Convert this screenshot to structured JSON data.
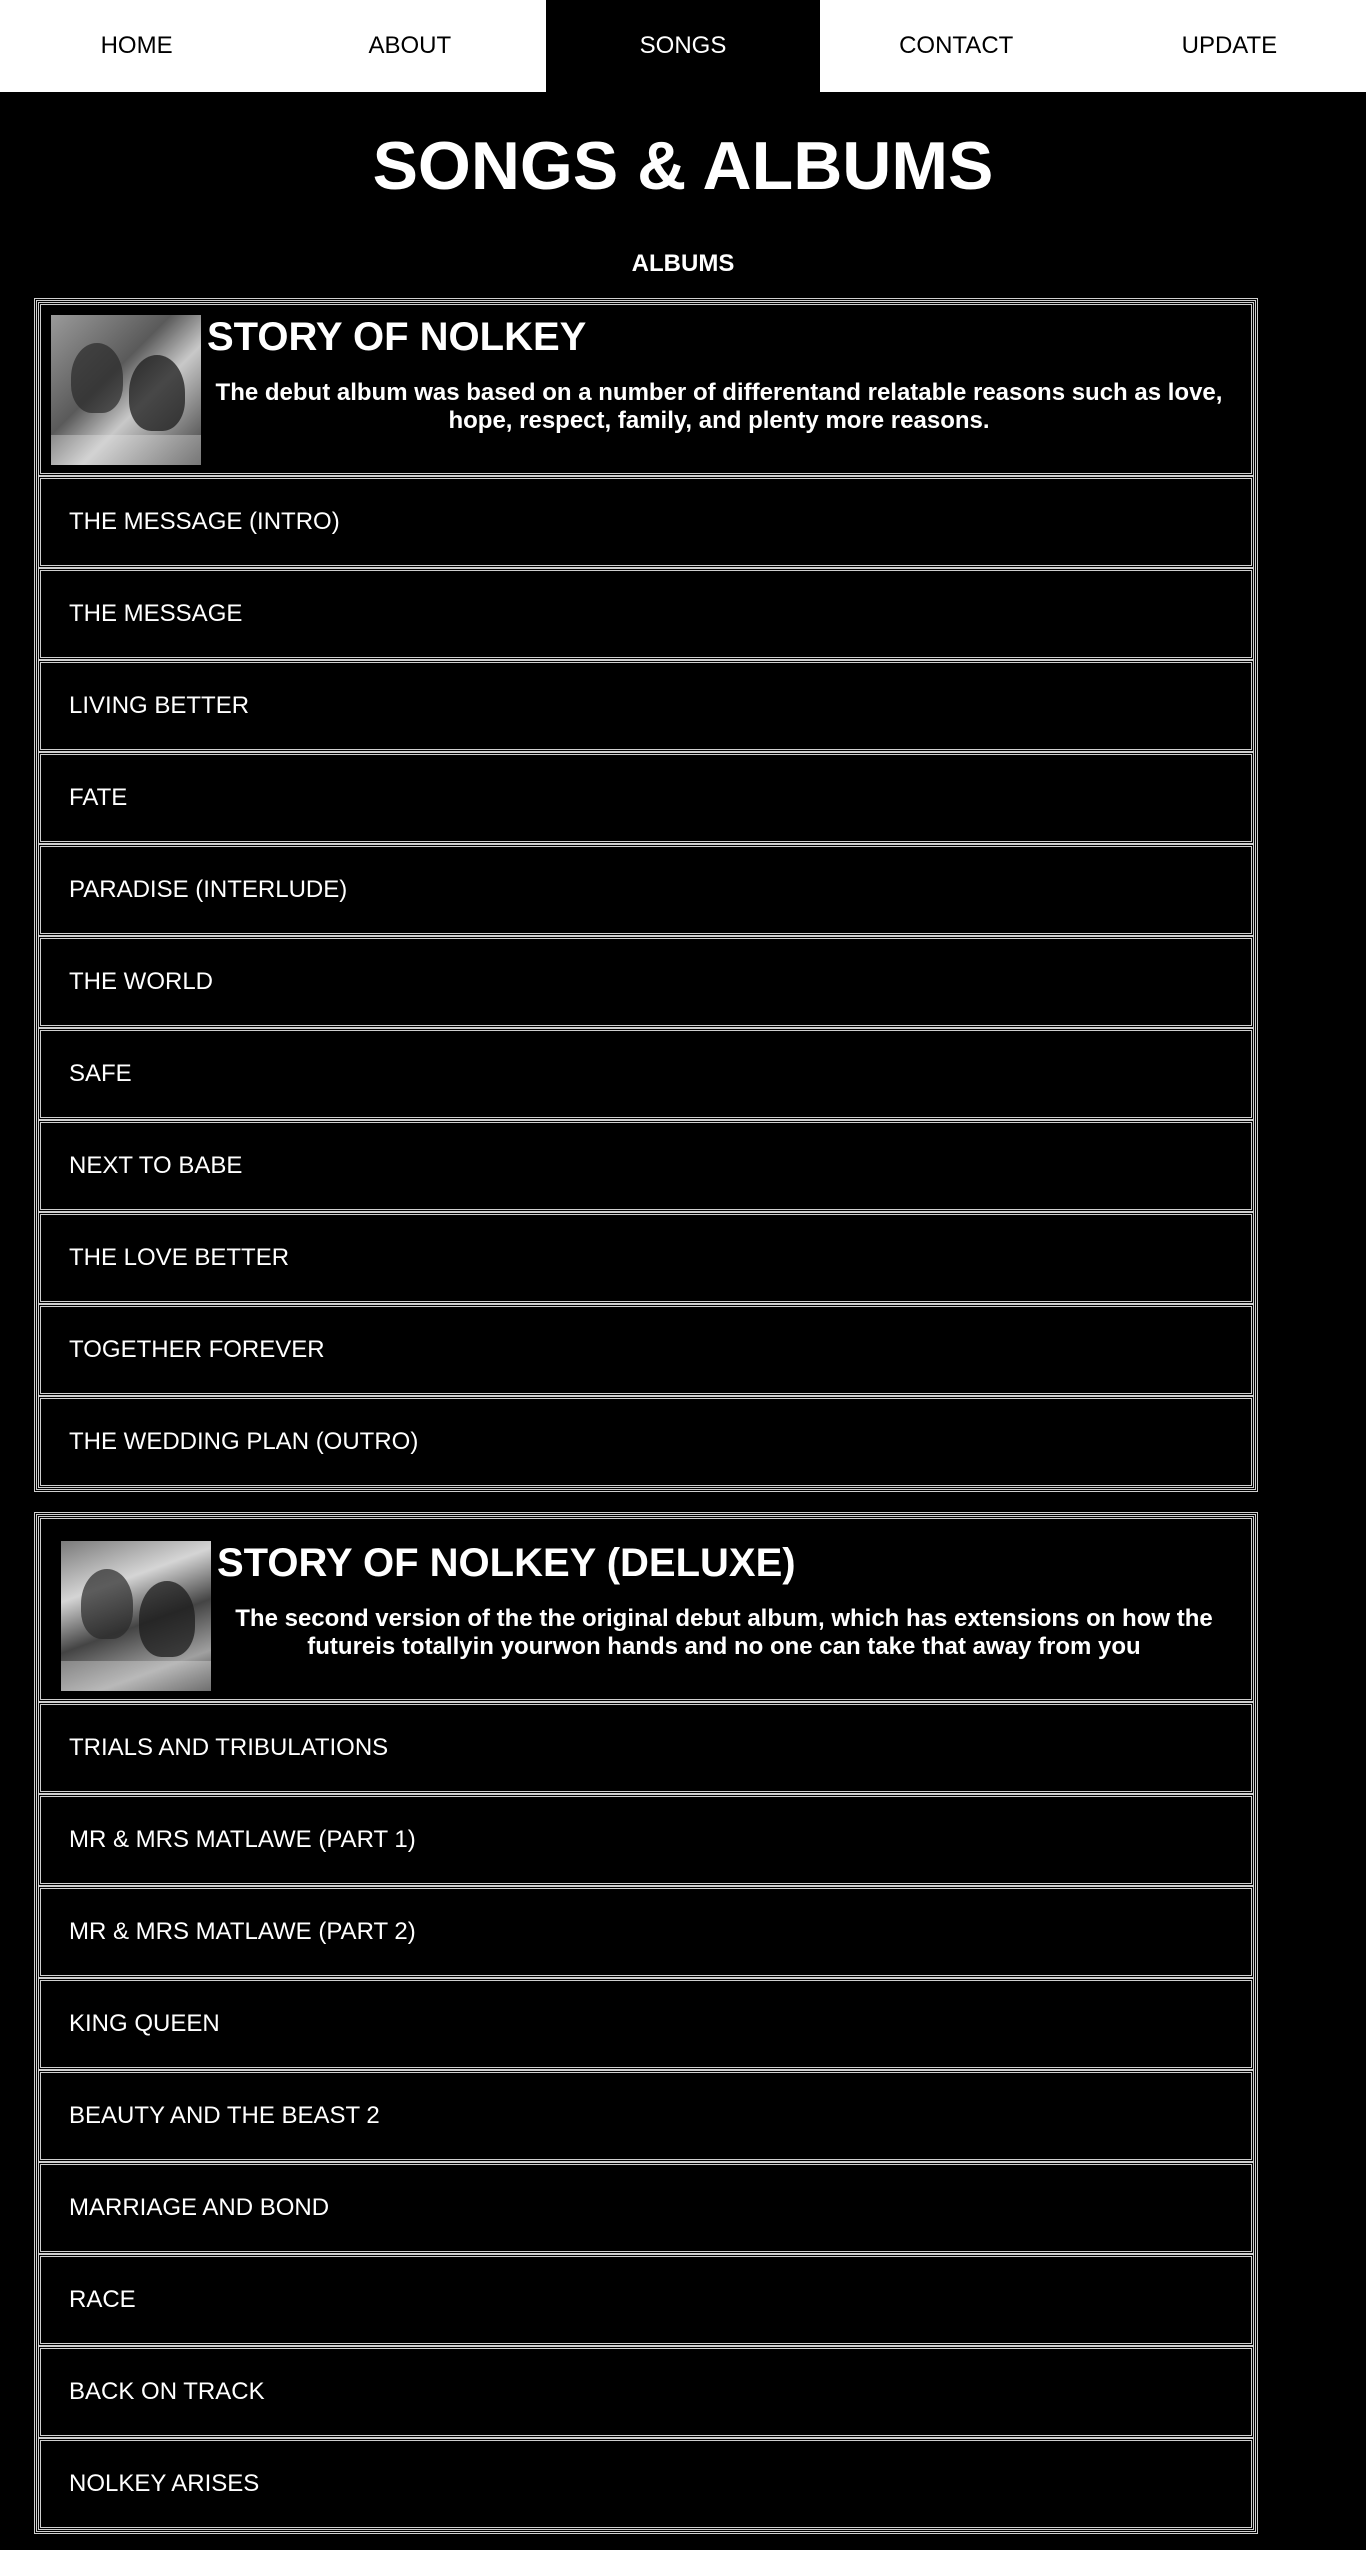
{
  "nav": {
    "items": [
      {
        "label": "HOME",
        "active": false
      },
      {
        "label": "ABOUT",
        "active": false
      },
      {
        "label": "SONGS",
        "active": true
      },
      {
        "label": "CONTACT",
        "active": false
      },
      {
        "label": "UPDATE",
        "active": false
      }
    ]
  },
  "page": {
    "title": "SONGS & ALBUMS",
    "section": "ALBUMS"
  },
  "albums": [
    {
      "title": "STORY OF NOLKEY",
      "description": "The debut album was based on a number of differentand relatable reasons such as love, hope, respect, family, and plenty more reasons.",
      "tracks": [
        "THE MESSAGE (INTRO)",
        "THE MESSAGE",
        "LIVING BETTER",
        "FATE",
        "PARADISE (INTERLUDE)",
        "THE WORLD",
        "SAFE",
        "NEXT TO BABE",
        "THE LOVE BETTER",
        "TOGETHER FOREVER",
        "THE WEDDING PLAN (OUTRO)"
      ]
    },
    {
      "title": "STORY OF NOLKEY (DELUXE)",
      "description": "The second version of the the original debut album, which has extensions on how the futureis totallyin yourwon hands and no one can take that away from you",
      "tracks": [
        "TRIALS AND TRIBULATIONS",
        "MR & MRS MATLAWE (PART 1)",
        "MR & MRS MATLAWE (PART 2)",
        "KING QUEEN",
        "BEAUTY AND THE BEAST 2",
        "MARRIAGE AND BOND",
        "RACE",
        "BACK ON TRACK",
        "NOLKEY ARISES"
      ]
    }
  ],
  "colors": {
    "background": "#000000",
    "nav_background": "#ffffff",
    "text": "#ffffff",
    "border": "#cfcfcf"
  }
}
